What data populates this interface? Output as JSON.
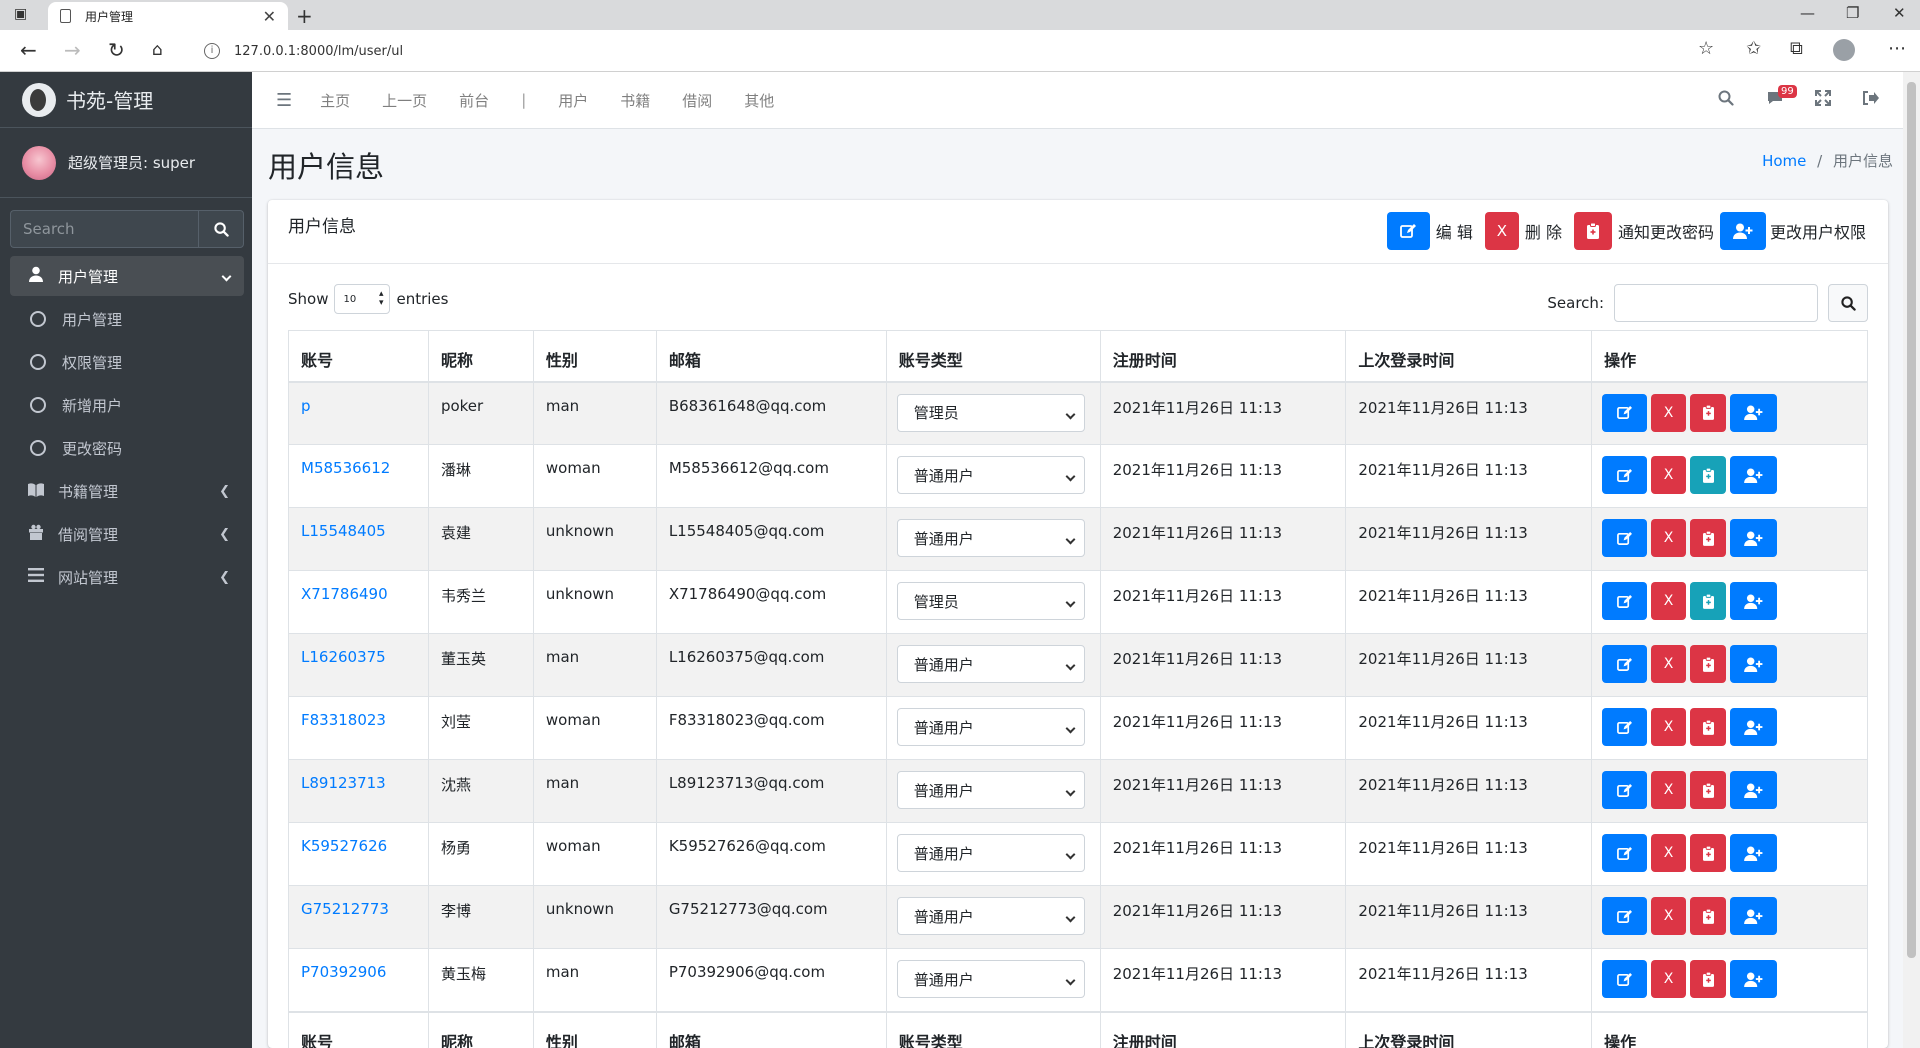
{
  "browser": {
    "tab_title": "用户管理",
    "url": "127.0.0.1:8000/lm/user/ul"
  },
  "sidebar": {
    "brand": "书苑-管理",
    "user": "超级管理员: super",
    "search_placeholder": "Search",
    "menu": [
      {
        "label": "用户管理",
        "icon": "user-icon",
        "active": true,
        "arrow": "chevron-down-icon"
      },
      {
        "label": "用户管理",
        "icon": "circle-icon"
      },
      {
        "label": "权限管理",
        "icon": "circle-icon"
      },
      {
        "label": "新增用户",
        "icon": "circle-icon"
      },
      {
        "label": "更改密码",
        "icon": "circle-icon"
      },
      {
        "label": "书籍管理",
        "icon": "book-icon",
        "arrow": "chevron-left-icon"
      },
      {
        "label": "借阅管理",
        "icon": "gift-icon",
        "arrow": "chevron-left-icon"
      },
      {
        "label": "网站管理",
        "icon": "list-icon",
        "arrow": "chevron-left-icon"
      }
    ]
  },
  "topnav": {
    "links": [
      "主页",
      "上一页",
      "前台",
      "|",
      "用户",
      "书籍",
      "借阅",
      "其他"
    ],
    "badge": "99"
  },
  "header": {
    "title": "用户信息",
    "breadcrumb_home": "Home",
    "breadcrumb_sep": "/",
    "breadcrumb_current": "用户信息"
  },
  "card": {
    "title": "用户信息",
    "tools": {
      "edit": "编 辑",
      "delete_icon_text": "X",
      "delete": "删 除",
      "notify": "通知更改密码",
      "perm": "更改用户权限"
    },
    "show_label": "Show",
    "show_value": "10",
    "entries_label": "entries",
    "search_label": "Search:"
  },
  "table": {
    "columns": [
      "账号",
      "昵称",
      "性别",
      "邮箱",
      "账号类型",
      "注册时间",
      "上次登录时间",
      "操作"
    ],
    "rows": [
      {
        "account": "p",
        "nick": "poker",
        "gender": "man",
        "email": "B68361648@qq.com",
        "type": "管理员",
        "reg": "2021年11月26日 11:13",
        "last": "2021年11月26日 11:13",
        "notify_color": "#dc3545"
      },
      {
        "account": "M58536612",
        "nick": "潘琳",
        "gender": "woman",
        "email": "M58536612@qq.com",
        "type": "普通用户",
        "reg": "2021年11月26日 11:13",
        "last": "2021年11月26日 11:13",
        "notify_color": "#17a2b8"
      },
      {
        "account": "L15548405",
        "nick": "袁建",
        "gender": "unknown",
        "email": "L15548405@qq.com",
        "type": "普通用户",
        "reg": "2021年11月26日 11:13",
        "last": "2021年11月26日 11:13",
        "notify_color": "#dc3545"
      },
      {
        "account": "X71786490",
        "nick": "韦秀兰",
        "gender": "unknown",
        "email": "X71786490@qq.com",
        "type": "管理员",
        "reg": "2021年11月26日 11:13",
        "last": "2021年11月26日 11:13",
        "notify_color": "#17a2b8"
      },
      {
        "account": "L16260375",
        "nick": "董玉英",
        "gender": "man",
        "email": "L16260375@qq.com",
        "type": "普通用户",
        "reg": "2021年11月26日 11:13",
        "last": "2021年11月26日 11:13",
        "notify_color": "#dc3545"
      },
      {
        "account": "F83318023",
        "nick": "刘莹",
        "gender": "woman",
        "email": "F83318023@qq.com",
        "type": "普通用户",
        "reg": "2021年11月26日 11:13",
        "last": "2021年11月26日 11:13",
        "notify_color": "#dc3545"
      },
      {
        "account": "L89123713",
        "nick": "沈燕",
        "gender": "man",
        "email": "L89123713@qq.com",
        "type": "普通用户",
        "reg": "2021年11月26日 11:13",
        "last": "2021年11月26日 11:13",
        "notify_color": "#dc3545"
      },
      {
        "account": "K59527626",
        "nick": "杨勇",
        "gender": "woman",
        "email": "K59527626@qq.com",
        "type": "普通用户",
        "reg": "2021年11月26日 11:13",
        "last": "2021年11月26日 11:13",
        "notify_color": "#dc3545"
      },
      {
        "account": "G75212773",
        "nick": "李博",
        "gender": "unknown",
        "email": "G75212773@qq.com",
        "type": "普通用户",
        "reg": "2021年11月26日 11:13",
        "last": "2021年11月26日 11:13",
        "notify_color": "#dc3545"
      },
      {
        "account": "P70392906",
        "nick": "黄玉梅",
        "gender": "man",
        "email": "P70392906@qq.com",
        "type": "普通用户",
        "reg": "2021年11月26日 11:13",
        "last": "2021年11月26日 11:13",
        "notify_color": "#dc3545"
      }
    ]
  },
  "colors": {
    "primary": "#007bff",
    "danger": "#dc3545",
    "info": "#17a2b8",
    "sidebar": "#343a40"
  }
}
